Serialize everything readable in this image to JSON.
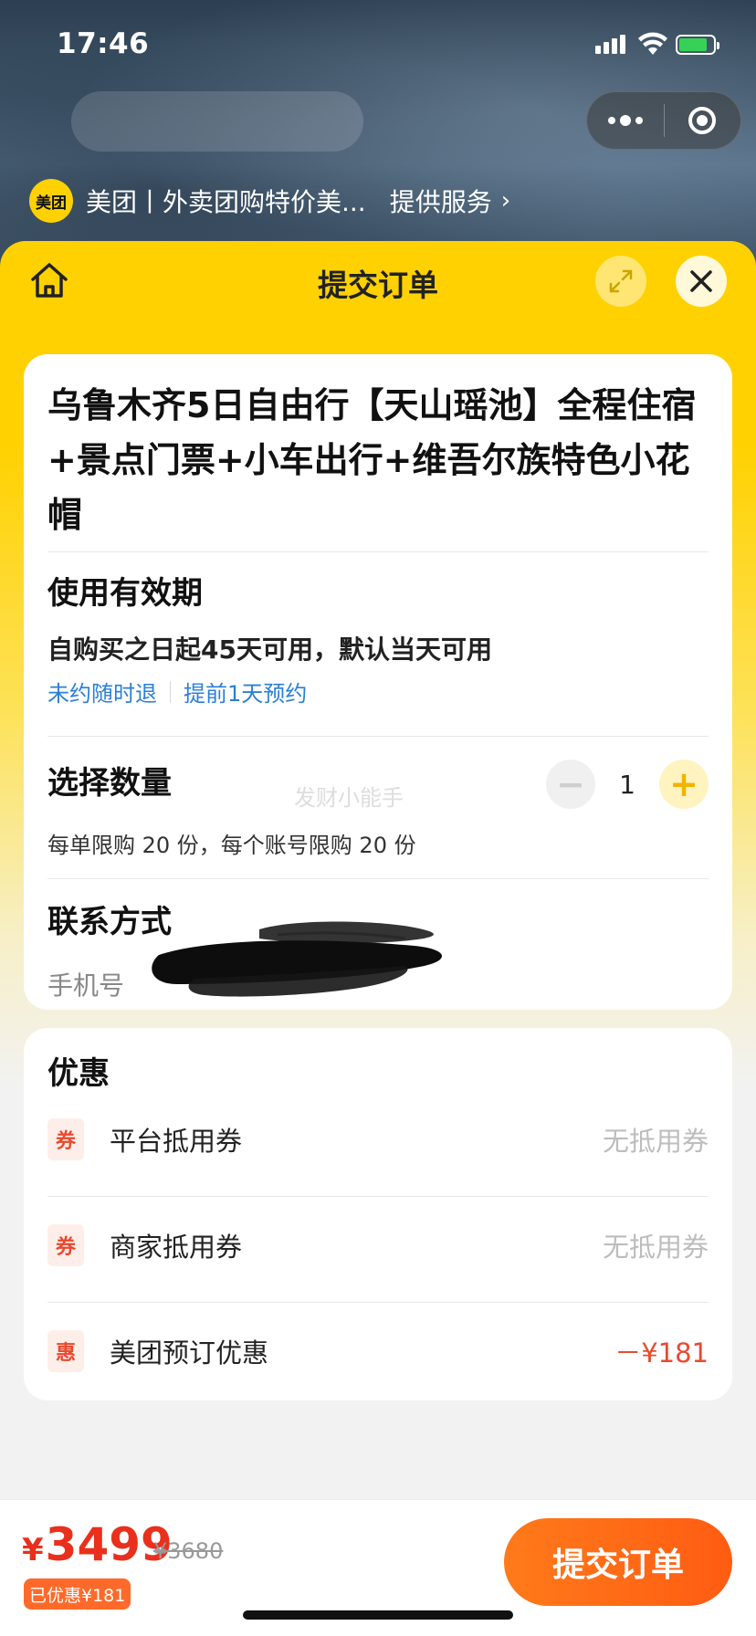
{
  "status_bar": {
    "time": "17:46"
  },
  "provider": {
    "logo_text": "美团",
    "name": "美团丨外卖团购特价美...",
    "service": "提供服务",
    "chevron": "›"
  },
  "nav": {
    "title": "提交订单",
    "close_glyph": "✕"
  },
  "product": {
    "title": "乌鲁木齐5日自由行【天山瑶池】全程住宿+景点门票+小车出行+维吾尔族特色小花帽"
  },
  "validity": {
    "title": "使用有效期",
    "text": "自购买之日起45天可用，默认当天可用",
    "tags": [
      "未约随时退",
      "提前1天预约"
    ]
  },
  "quantity": {
    "title": "选择数量",
    "value": "1",
    "minus": "−",
    "plus": "+",
    "note": "每单限购 20 份，每个账号限购 20 份",
    "watermark": "发财小能手"
  },
  "contact": {
    "title": "联系方式",
    "phone_label": "手机号"
  },
  "discounts": {
    "title": "优惠",
    "rows": [
      {
        "badge": "券",
        "label": "平台抵用券",
        "value": "无抵用券"
      },
      {
        "badge": "券",
        "label": "商家抵用券",
        "value": "无抵用券"
      },
      {
        "badge": "惠",
        "label": "美团预订优惠",
        "value": "－¥181"
      }
    ]
  },
  "footer": {
    "currency": "¥",
    "price": "3499",
    "original_price": "¥3680",
    "saved": "已优惠¥181",
    "submit": "提交订单"
  },
  "colors": {
    "brand_yellow": "#ffd100",
    "accent_orange": "#ff6a1a",
    "price_red": "#e9301d",
    "link_blue": "#2b7fd8"
  }
}
